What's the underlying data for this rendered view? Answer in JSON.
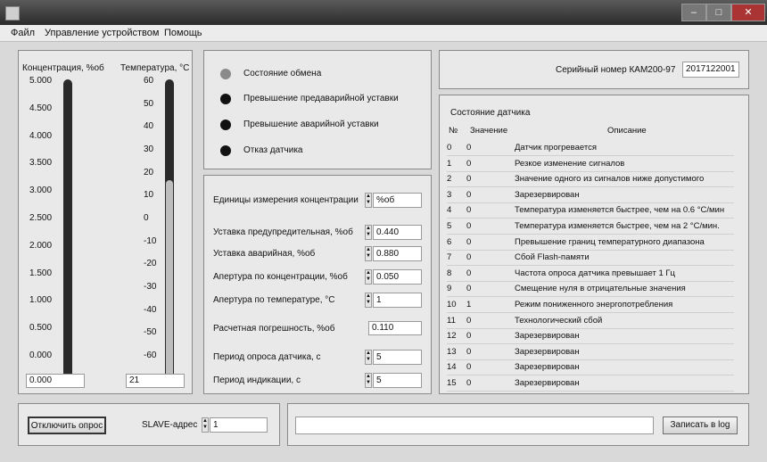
{
  "menu": [
    "Файл",
    "Управление устройством",
    "Помощь"
  ],
  "gauges": {
    "conc_label": "Концентрация, %об",
    "temp_label": "Температура, °С",
    "conc_ticks": [
      "5.000",
      "4.500",
      "4.000",
      "3.500",
      "3.000",
      "2.500",
      "2.000",
      "1.500",
      "1.000",
      "0.500",
      "0.000"
    ],
    "temp_ticks": [
      "60",
      "50",
      "40",
      "30",
      "20",
      "10",
      "0",
      "-10",
      "-20",
      "-30",
      "-40",
      "-50",
      "-60"
    ],
    "conc_value": "0.000",
    "temp_value": "21",
    "conc_level": 0.0,
    "temp_level": 0.675
  },
  "status": {
    "items": [
      "Состояние обмена",
      "Превышение предаварийной уставки",
      "Превышение аварийной уставки",
      "Отказ датчика"
    ],
    "colors": [
      "#8a8a8a",
      "#111111",
      "#111111",
      "#111111"
    ]
  },
  "settings": {
    "units_label": "Единицы измерения концентрации",
    "units_value": "%об",
    "warn_label": "Уставка предупредительная, %об",
    "warn_value": "0.440",
    "alarm_label": "Уставка аварийная, %об",
    "alarm_value": "0.880",
    "ap_conc_label": "Апертура по концентрации, %об",
    "ap_conc_value": "0.050",
    "ap_temp_label": "Апертура по температуре, °С",
    "ap_temp_value": "1",
    "err_label": "Расчетная погрешность, %об",
    "err_value": "0.110",
    "poll_label": "Период опроса датчика, с",
    "poll_value": "5",
    "ind_label": "Период индикации, с",
    "ind_value": "5"
  },
  "serial": {
    "label": "Серийный номер КАМ200-97",
    "value": "2017122001"
  },
  "sensor": {
    "title": "Состояние датчика",
    "headers": [
      "№",
      "Значение",
      "Описание"
    ],
    "rows": [
      [
        "0",
        "0",
        "Датчик прогревается"
      ],
      [
        "1",
        "0",
        "Резкое изменение сигналов"
      ],
      [
        "2",
        "0",
        "Значение одного из сигналов ниже допустимого"
      ],
      [
        "3",
        "0",
        "Зарезервирован"
      ],
      [
        "4",
        "0",
        "Температура изменяется быстрее, чем на 0.6 °С/мин"
      ],
      [
        "5",
        "0",
        "Температура изменяется быстрее, чем на 2 °С/мин."
      ],
      [
        "6",
        "0",
        "Превышение границ температурного диапазона"
      ],
      [
        "7",
        "0",
        "Сбой  Flash-памяти"
      ],
      [
        "8",
        "0",
        "Частота опроса датчика превышает 1 Гц"
      ],
      [
        "9",
        "0",
        "Смещение нуля в отрицательные значения"
      ],
      [
        "10",
        "1",
        "Режим пониженного энергопотребления"
      ],
      [
        "11",
        "0",
        "Технологический сбой"
      ],
      [
        "12",
        "0",
        "Зарезервирован"
      ],
      [
        "13",
        "0",
        "Зарезервирован"
      ],
      [
        "14",
        "0",
        "Зарезервирован"
      ],
      [
        "15",
        "0",
        "Зарезервирован"
      ]
    ]
  },
  "bottom": {
    "disconnect_label": "Отключить опрос",
    "slave_label": "SLAVE-адрес",
    "slave_value": "1",
    "log_value": "",
    "log_button": "Записать в log"
  }
}
